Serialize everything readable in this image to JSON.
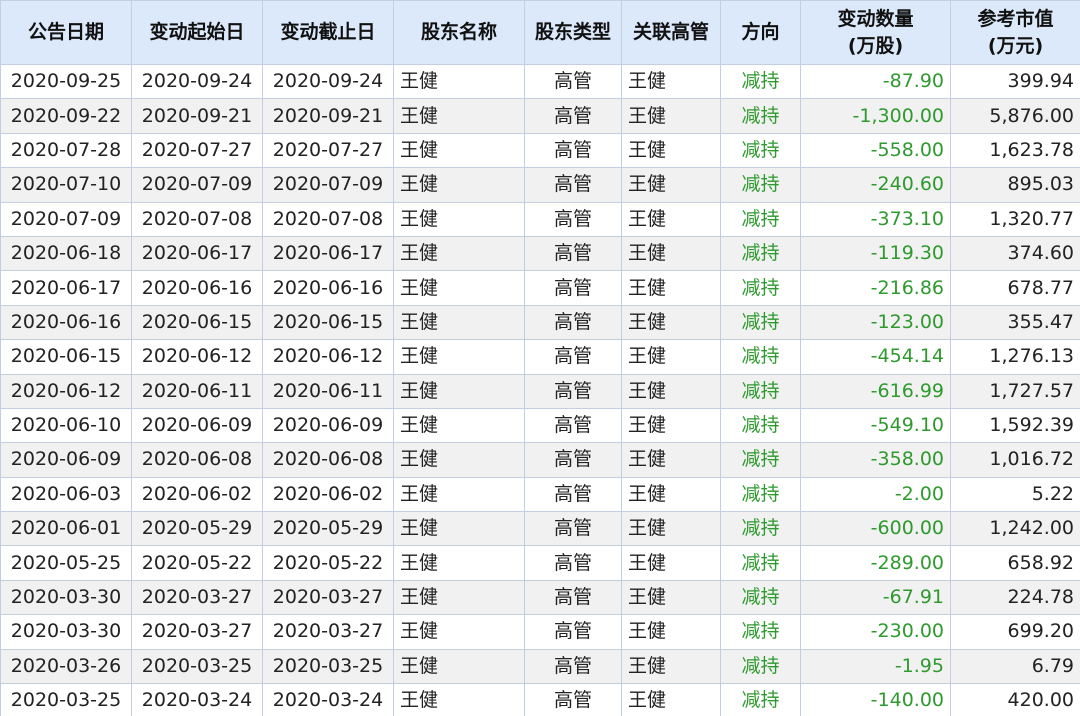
{
  "colors": {
    "header_bg": "#dce9fb",
    "header_text": "#111111",
    "border": "#c3cfdf",
    "stripe": "#f1f1f1",
    "green": "#2e9a2e"
  },
  "table": {
    "headers": {
      "announce_date": "公告日期",
      "start_date": "变动起始日",
      "end_date": "变动截止日",
      "holder_name": "股东名称",
      "holder_type": "股东类型",
      "related_exec": "关联高管",
      "direction": "方向",
      "change_qty_line1": "变动数量",
      "change_qty_line2": "(万股)",
      "ref_value_line1": "参考市值",
      "ref_value_line2": "(万元)"
    },
    "rows": [
      {
        "announce_date": "2020-09-25",
        "start_date": "2020-09-24",
        "end_date": "2020-09-24",
        "holder_name": "王健",
        "holder_type": "高管",
        "related_exec": "王健",
        "direction": "减持",
        "change_qty": "-87.90",
        "ref_value": "399.94"
      },
      {
        "announce_date": "2020-09-22",
        "start_date": "2020-09-21",
        "end_date": "2020-09-21",
        "holder_name": "王健",
        "holder_type": "高管",
        "related_exec": "王健",
        "direction": "减持",
        "change_qty": "-1,300.00",
        "ref_value": "5,876.00"
      },
      {
        "announce_date": "2020-07-28",
        "start_date": "2020-07-27",
        "end_date": "2020-07-27",
        "holder_name": "王健",
        "holder_type": "高管",
        "related_exec": "王健",
        "direction": "减持",
        "change_qty": "-558.00",
        "ref_value": "1,623.78"
      },
      {
        "announce_date": "2020-07-10",
        "start_date": "2020-07-09",
        "end_date": "2020-07-09",
        "holder_name": "王健",
        "holder_type": "高管",
        "related_exec": "王健",
        "direction": "减持",
        "change_qty": "-240.60",
        "ref_value": "895.03"
      },
      {
        "announce_date": "2020-07-09",
        "start_date": "2020-07-08",
        "end_date": "2020-07-08",
        "holder_name": "王健",
        "holder_type": "高管",
        "related_exec": "王健",
        "direction": "减持",
        "change_qty": "-373.10",
        "ref_value": "1,320.77"
      },
      {
        "announce_date": "2020-06-18",
        "start_date": "2020-06-17",
        "end_date": "2020-06-17",
        "holder_name": "王健",
        "holder_type": "高管",
        "related_exec": "王健",
        "direction": "减持",
        "change_qty": "-119.30",
        "ref_value": "374.60"
      },
      {
        "announce_date": "2020-06-17",
        "start_date": "2020-06-16",
        "end_date": "2020-06-16",
        "holder_name": "王健",
        "holder_type": "高管",
        "related_exec": "王健",
        "direction": "减持",
        "change_qty": "-216.86",
        "ref_value": "678.77"
      },
      {
        "announce_date": "2020-06-16",
        "start_date": "2020-06-15",
        "end_date": "2020-06-15",
        "holder_name": "王健",
        "holder_type": "高管",
        "related_exec": "王健",
        "direction": "减持",
        "change_qty": "-123.00",
        "ref_value": "355.47"
      },
      {
        "announce_date": "2020-06-15",
        "start_date": "2020-06-12",
        "end_date": "2020-06-12",
        "holder_name": "王健",
        "holder_type": "高管",
        "related_exec": "王健",
        "direction": "减持",
        "change_qty": "-454.14",
        "ref_value": "1,276.13"
      },
      {
        "announce_date": "2020-06-12",
        "start_date": "2020-06-11",
        "end_date": "2020-06-11",
        "holder_name": "王健",
        "holder_type": "高管",
        "related_exec": "王健",
        "direction": "减持",
        "change_qty": "-616.99",
        "ref_value": "1,727.57"
      },
      {
        "announce_date": "2020-06-10",
        "start_date": "2020-06-09",
        "end_date": "2020-06-09",
        "holder_name": "王健",
        "holder_type": "高管",
        "related_exec": "王健",
        "direction": "减持",
        "change_qty": "-549.10",
        "ref_value": "1,592.39"
      },
      {
        "announce_date": "2020-06-09",
        "start_date": "2020-06-08",
        "end_date": "2020-06-08",
        "holder_name": "王健",
        "holder_type": "高管",
        "related_exec": "王健",
        "direction": "减持",
        "change_qty": "-358.00",
        "ref_value": "1,016.72"
      },
      {
        "announce_date": "2020-06-03",
        "start_date": "2020-06-02",
        "end_date": "2020-06-02",
        "holder_name": "王健",
        "holder_type": "高管",
        "related_exec": "王健",
        "direction": "减持",
        "change_qty": "-2.00",
        "ref_value": "5.22"
      },
      {
        "announce_date": "2020-06-01",
        "start_date": "2020-05-29",
        "end_date": "2020-05-29",
        "holder_name": "王健",
        "holder_type": "高管",
        "related_exec": "王健",
        "direction": "减持",
        "change_qty": "-600.00",
        "ref_value": "1,242.00"
      },
      {
        "announce_date": "2020-05-25",
        "start_date": "2020-05-22",
        "end_date": "2020-05-22",
        "holder_name": "王健",
        "holder_type": "高管",
        "related_exec": "王健",
        "direction": "减持",
        "change_qty": "-289.00",
        "ref_value": "658.92"
      },
      {
        "announce_date": "2020-03-30",
        "start_date": "2020-03-27",
        "end_date": "2020-03-27",
        "holder_name": "王健",
        "holder_type": "高管",
        "related_exec": "王健",
        "direction": "减持",
        "change_qty": "-67.91",
        "ref_value": "224.78"
      },
      {
        "announce_date": "2020-03-30",
        "start_date": "2020-03-27",
        "end_date": "2020-03-27",
        "holder_name": "王健",
        "holder_type": "高管",
        "related_exec": "王健",
        "direction": "减持",
        "change_qty": "-230.00",
        "ref_value": "699.20"
      },
      {
        "announce_date": "2020-03-26",
        "start_date": "2020-03-25",
        "end_date": "2020-03-25",
        "holder_name": "王健",
        "holder_type": "高管",
        "related_exec": "王健",
        "direction": "减持",
        "change_qty": "-1.95",
        "ref_value": "6.79"
      },
      {
        "announce_date": "2020-03-25",
        "start_date": "2020-03-24",
        "end_date": "2020-03-24",
        "holder_name": "王健",
        "holder_type": "高管",
        "related_exec": "王健",
        "direction": "减持",
        "change_qty": "-140.00",
        "ref_value": "420.00"
      }
    ]
  }
}
